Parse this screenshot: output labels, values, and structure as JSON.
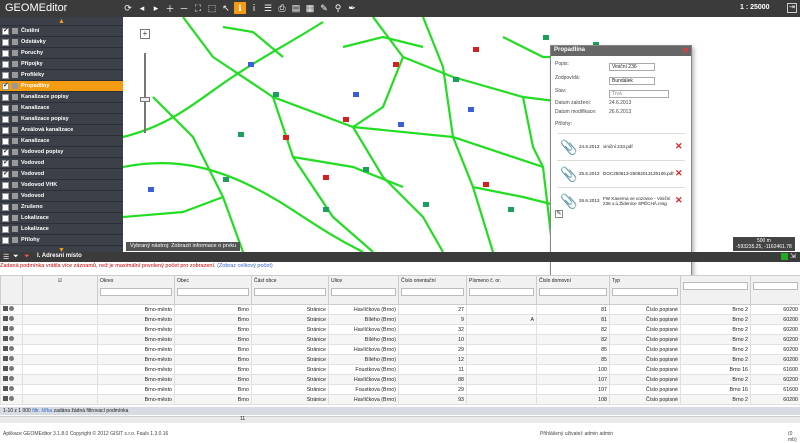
{
  "app": {
    "title": "GEOMEditor",
    "scale": "1 : 25000"
  },
  "layers": [
    {
      "label": "Čistění",
      "checked": true,
      "selected": false
    },
    {
      "label": "Odstávky",
      "checked": false,
      "selected": false
    },
    {
      "label": "Poruchy",
      "checked": false,
      "selected": false
    },
    {
      "label": "Přípojky",
      "checked": false,
      "selected": false
    },
    {
      "label": "Profiléky",
      "checked": false,
      "selected": false
    },
    {
      "label": "Propadliny",
      "checked": true,
      "selected": true
    },
    {
      "label": "Kanalizace popisy",
      "checked": false,
      "selected": false
    },
    {
      "label": "Kanalizace",
      "checked": false,
      "selected": false
    },
    {
      "label": "Kanalizace popisy",
      "checked": false,
      "selected": false
    },
    {
      "label": "Areálová kanalizace",
      "checked": false,
      "selected": false
    },
    {
      "label": "Kanalizace",
      "checked": false,
      "selected": false
    },
    {
      "label": "Vodovod popisy",
      "checked": true,
      "selected": false
    },
    {
      "label": "Vodovod",
      "checked": true,
      "selected": false
    },
    {
      "label": "Vodovod",
      "checked": true,
      "selected": false
    },
    {
      "label": "Vodovod VHK",
      "checked": false,
      "selected": false
    },
    {
      "label": "Vodovod",
      "checked": false,
      "selected": false
    },
    {
      "label": "Zrušeno",
      "checked": false,
      "selected": false
    },
    {
      "label": "Lokalizace",
      "checked": false,
      "selected": false
    },
    {
      "label": "Lokalizace",
      "checked": false,
      "selected": false
    },
    {
      "label": "Přílohy",
      "checked": false,
      "selected": false
    }
  ],
  "map": {
    "hint": "Vybraný nástroj: Zobrazit informace o prvku",
    "scale_bar": "500 m",
    "coords": "-593235.25, -1162461.78"
  },
  "panel": {
    "title": "Propadlina",
    "popis_label": "Popis:",
    "popis_value": "Viniční 236",
    "zodpovida_label": "Zodpovídá:",
    "zodpovida_value": "Bundálek",
    "stav_label": "Stav:",
    "stav_value": "Trvá",
    "zalozeni_label": "Datum založení:",
    "zalozeni_value": "24.6.2013",
    "modifikace_label": "Datum modifikace:",
    "modifikace_value": "26.6.2013",
    "prilohy_label": "Přílohy:",
    "attachments": [
      {
        "date": "24.6.2013",
        "name": "viniční 233.pdf"
      },
      {
        "date": "25.6.2013",
        "name": "DOC250613-25062013130106.pdf"
      },
      {
        "date": "26.6.2013",
        "name": "FW Kaverna ve vozovce - Viniční 236 x.ú.Židenice SPĚCHÁ.msg"
      }
    ]
  },
  "grid": {
    "title": "I. Adresní místo",
    "warning": "Zadaná podmínka vrátila více záznamů, než je maximální povolený počet pro zobrazení.",
    "warning_link": "(Zobraz celkový počet)",
    "columns": [
      "Okres",
      "Obec",
      "Část obce",
      "Ulice",
      "Číslo orientační",
      "Písmeno č. or.",
      "Číslo domovní",
      "Typ",
      "",
      "",
      "Katastrální územ"
    ],
    "rows": [
      [
        "Brno-město",
        "Brno",
        "Stránice",
        "Havlíčkova (Brno)",
        "27",
        "",
        "81",
        "Číslo popisné",
        "Brno 2",
        "60200",
        ""
      ],
      [
        "Brno-město",
        "Brno",
        "Stránice",
        "Bílého (Brno)",
        "9",
        "A",
        "81",
        "Číslo popisné",
        "Brno 2",
        "60200",
        ""
      ],
      [
        "Brno-město",
        "Brno",
        "Stránice",
        "Havlíčkova (Brno)",
        "32",
        "",
        "82",
        "Číslo popisné",
        "Brno 2",
        "60200",
        ""
      ],
      [
        "Brno-město",
        "Brno",
        "Stránice",
        "Bílého (Brno)",
        "10",
        "",
        "82",
        "Číslo popisné",
        "Brno 2",
        "60200",
        ""
      ],
      [
        "Brno-město",
        "Brno",
        "Stránice",
        "Havlíčkova (Brno)",
        "29",
        "",
        "85",
        "Číslo popisné",
        "Brno 2",
        "60200",
        ""
      ],
      [
        "Brno-město",
        "Brno",
        "Stránice",
        "Bílého (Brno)",
        "12",
        "",
        "85",
        "Číslo popisné",
        "Brno 2",
        "60200",
        ""
      ],
      [
        "Brno-město",
        "Brno",
        "Stránice",
        "Foustkova (Brno)",
        "11",
        "",
        "100",
        "Číslo popisné",
        "Brno 16",
        "61600",
        ""
      ],
      [
        "Brno-město",
        "Brno",
        "Stránice",
        "Havlíčkova (Brno)",
        "88",
        "",
        "107",
        "Číslo popisné",
        "Brno 2",
        "60200",
        ""
      ],
      [
        "Brno-město",
        "Brno",
        "Stránice",
        "Foustkova (Brno)",
        "29",
        "",
        "107",
        "Číslo popisné",
        "Brno 16",
        "61600",
        ""
      ],
      [
        "Brno-město",
        "Brno",
        "Stránice",
        "Havlíčkova (Brno)",
        "93",
        "",
        "108",
        "Číslo popisné",
        "Brno 2",
        "60200",
        ""
      ]
    ],
    "summary_count": "1-10 z 1 000",
    "summary_link": "filtr. šířka",
    "summary_text": "zadána žádná filtrovací podmínka",
    "page": "11"
  },
  "footer": {
    "left": "Aplikace GEOMEditor 3.1.8.0 Copyright © 2012 GISIT s.r.o.   Fauls   1.3.0.16",
    "user": "Přihlášený uživatel: admin admin",
    "right": "(0 mb)"
  }
}
